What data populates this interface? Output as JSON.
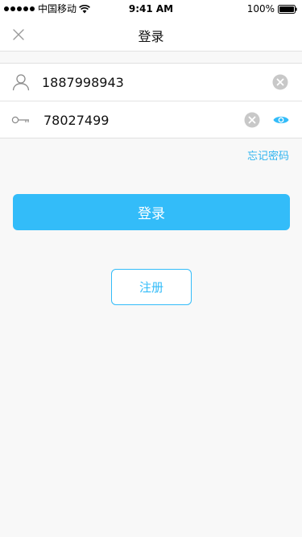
{
  "status_bar": {
    "carrier": "中国移动",
    "time": "9:41 AM",
    "battery": "100%"
  },
  "nav": {
    "title": "登录",
    "close_icon": "close-icon"
  },
  "form": {
    "phone": {
      "value": "1887998943",
      "icon": "user-icon"
    },
    "password": {
      "value": "78027499",
      "icon": "key-icon",
      "visibility_icon": "eye-icon"
    }
  },
  "forgot_password": "忘记密码",
  "login_label": "登录",
  "register_label": "注册",
  "colors": {
    "accent": "#33bcf9",
    "background": "#f8f8f8",
    "clear_icon": "#c8c8c8"
  }
}
